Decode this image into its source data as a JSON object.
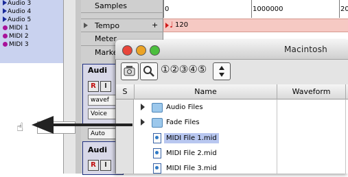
{
  "tracks": [
    {
      "name": "Audio 3",
      "kind": "audio"
    },
    {
      "name": "Audio 4",
      "kind": "audio"
    },
    {
      "name": "Audio 5",
      "kind": "audio"
    },
    {
      "name": "MIDI 1",
      "kind": "midi"
    },
    {
      "name": "MIDI 2",
      "kind": "midi"
    },
    {
      "name": "MIDI 3",
      "kind": "midi"
    }
  ],
  "rulers": {
    "samples": "Samples",
    "tempo": "Tempo",
    "meter": "Meter",
    "markers": "Marke",
    "add": "+",
    "timeline_start": "0",
    "timeline_mid": "1000000",
    "timeline_end": "20",
    "tempo_value": "120",
    "tempo_glyph": "♩"
  },
  "track_controls": {
    "audio_name_1": "Audi",
    "audio_name_2": "Audi",
    "record": "R",
    "input": "I",
    "waveform_btn": "wavef",
    "voice_btn": "Voice",
    "auto_btn": "Auto"
  },
  "workspace": {
    "title": "Macintosh",
    "numbers": "①②③④⑤",
    "columns": {
      "s": "S",
      "name": "Name",
      "waveform": "Waveform"
    },
    "rows": [
      {
        "name": "Audio Files",
        "type": "folder"
      },
      {
        "name": "Fade Files",
        "type": "folder"
      },
      {
        "name": "MIDI File 1.mid",
        "type": "file",
        "selected": true
      },
      {
        "name": "MIDI File 2.mid",
        "type": "file"
      },
      {
        "name": "MIDI File 3.mid",
        "type": "file"
      }
    ]
  },
  "colors": {
    "selection": "#b8c7f0",
    "tempo_bar": "#f6c9c3",
    "tempo_marker": "#d01818",
    "midi_dot": "#a8129a",
    "audio_triangle": "#1a2a9a"
  }
}
